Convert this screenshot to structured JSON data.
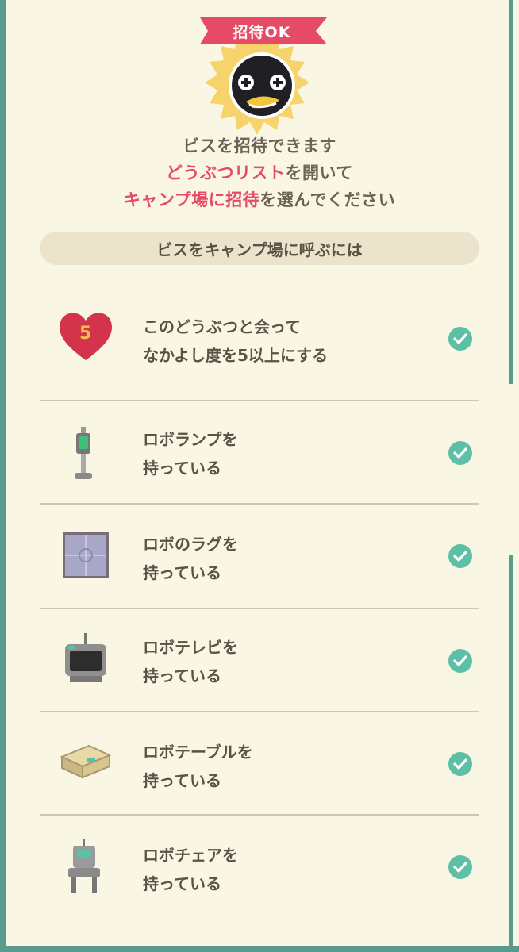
{
  "badge": {
    "label": "招待OK"
  },
  "intro": {
    "line1": "ビスを招待できます",
    "line2_highlight": "どうぶつリスト",
    "line2_rest": "を開いて",
    "line3_highlight": "キャンプ場に招待",
    "line3_rest": "を選んでください"
  },
  "section": {
    "title": "ビスをキャンプ場に呼ぶには"
  },
  "requirements": [
    {
      "line1": "このどうぶつと会って",
      "line2": "なかよし度を5以上にする",
      "icon": "heart-icon",
      "number": "5",
      "done": true
    },
    {
      "line1": "ロボランプを",
      "line2": "持っている",
      "icon": "robo-lamp-icon",
      "done": true
    },
    {
      "line1": "ロボのラグを",
      "line2": "持っている",
      "icon": "robo-rug-icon",
      "done": true
    },
    {
      "line1": "ロボテレビを",
      "line2": "持っている",
      "icon": "robo-tv-icon",
      "done": true
    },
    {
      "line1": "ロボテーブルを",
      "line2": "持っている",
      "icon": "robo-table-icon",
      "done": true
    },
    {
      "line1": "ロボチェアを",
      "line2": "持っている",
      "icon": "robo-chair-icon",
      "done": true
    }
  ],
  "colors": {
    "accent": "#e54b66",
    "check": "#5dbfa6",
    "panel": "#faf6e4",
    "frame": "#5b9a8e"
  }
}
